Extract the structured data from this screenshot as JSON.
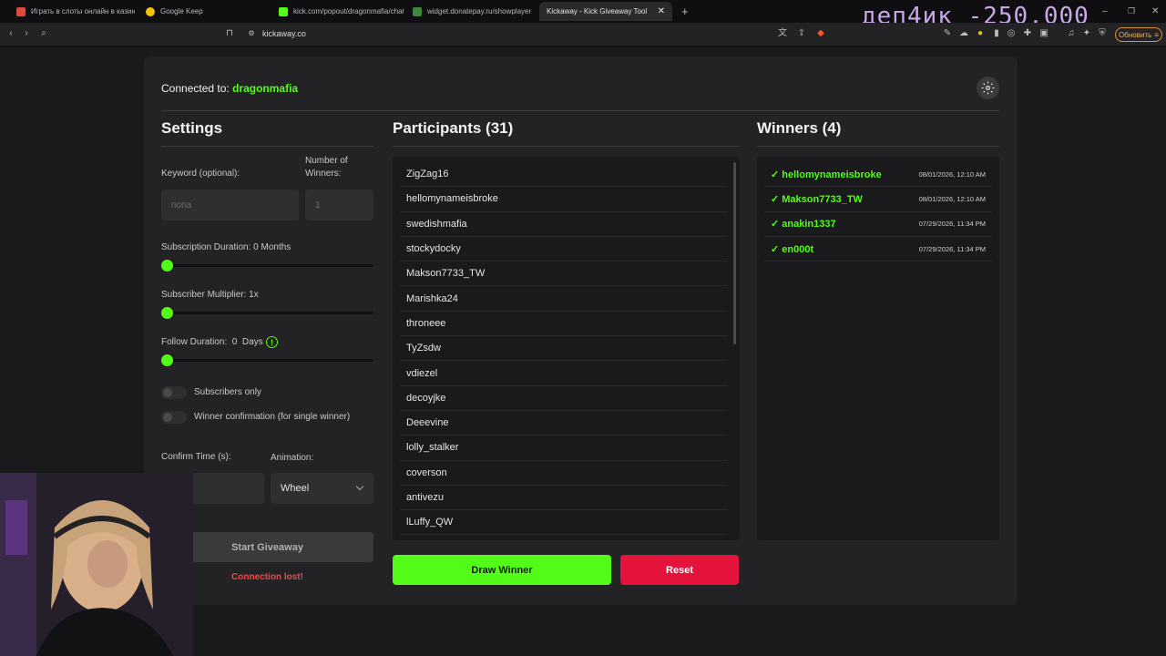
{
  "browser": {
    "tabs": [
      {
        "label": "Играть в слоты онлайн в казино",
        "color": "#e04a3a"
      },
      {
        "label": "Google Keep",
        "color": "#f5c400"
      },
      {
        "label": "kick.com/popout/dragonmafia/chat",
        "color": "#53fc18"
      },
      {
        "label": "widget.donatepay.ru/showplayer",
        "color": "#3a8a3a"
      },
      {
        "label": "Kickaway - Kick Giveaway Tool",
        "color": "#888888"
      }
    ],
    "url": "kickaway.co",
    "update_label": "Обновить",
    "overlay_text": "деп4ик -250.000"
  },
  "header": {
    "connected_label": "Connected to:",
    "channel": "dragonmafia"
  },
  "settings": {
    "title": "Settings",
    "keyword_label": "Keyword (optional):",
    "keyword_value": "попа",
    "winners_label_1": "Number of",
    "winners_label_2": "Winners:",
    "winners_value": "1",
    "sub_duration_label": "Subscription Duration: 0 Months",
    "sub_multiplier_label": "Subscriber Multiplier: 1x",
    "follow_duration_label": "Follow Duration:  0  Days",
    "subscribers_only_label": "Subscribers only",
    "winner_confirmation_label": "Winner confirmation (for single winner)",
    "confirm_time_label": "Confirm Time (s):",
    "animation_label": "Animation:",
    "animation_value": "Wheel",
    "start_label": "Start Giveaway",
    "connection_lost": "Connection lost!",
    "sub_duration_fraction": 0,
    "sub_multiplier_fraction": 0,
    "follow_duration_fraction": 0
  },
  "participants": {
    "title": "Participants (31)",
    "items": [
      "ZigZag16",
      "hellomynameisbroke",
      "swedishmafia",
      "stockydocky",
      "Makson7733_TW",
      "Marishka24",
      "throneee",
      "TyZsdw",
      "vdiezel",
      "decoyjke",
      "Deeevine",
      "lolly_stalker",
      "coverson",
      "antivezu",
      "lLuffy_QW"
    ]
  },
  "actions": {
    "draw_label": "Draw Winner",
    "reset_label": "Reset"
  },
  "winners": {
    "title": "Winners (4)",
    "items": [
      {
        "name": "✓ hellomynameisbroke",
        "date": "08/01/2026, 12:10 AM"
      },
      {
        "name": "✓ Makson7733_TW",
        "date": "08/01/2026, 12:10 AM"
      },
      {
        "name": "✓ anakin1337",
        "date": "07/29/2026, 11:34 PM"
      },
      {
        "name": "✓ en000t",
        "date": "07/29/2026, 11:34 PM"
      }
    ]
  },
  "colors": {
    "accent": "#53fc18",
    "danger": "#e4133c",
    "card": "#232325",
    "background": "#1a1a1c"
  }
}
